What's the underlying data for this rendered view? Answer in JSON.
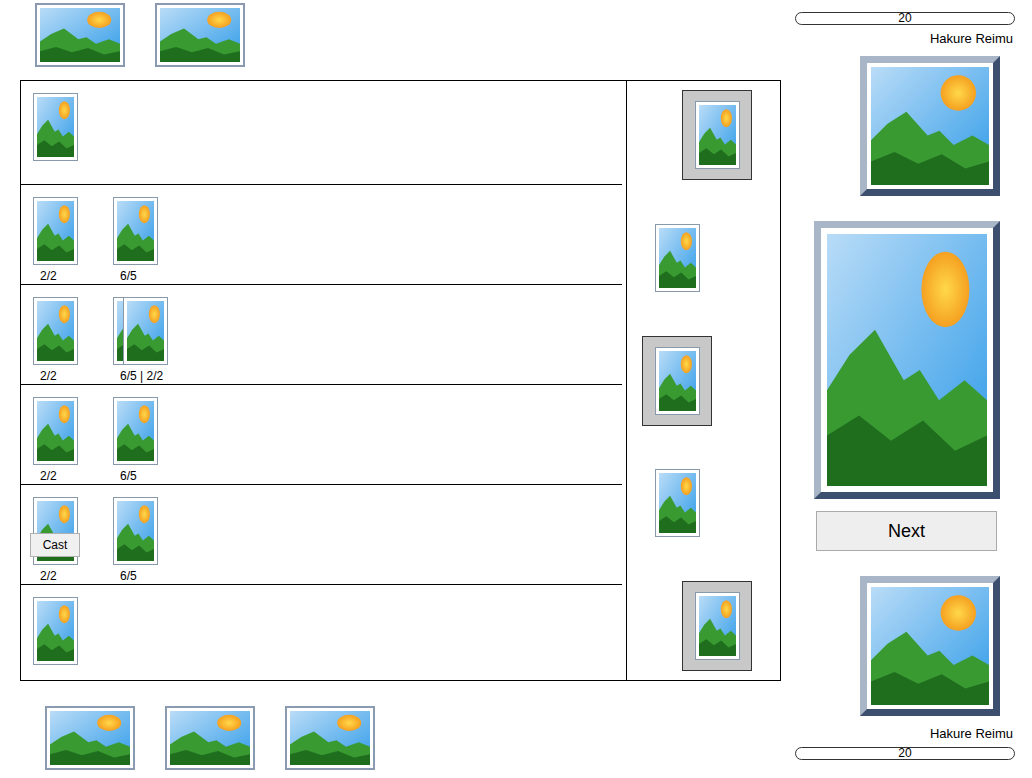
{
  "opponent": {
    "name": "Hakure Reimu",
    "life": "20",
    "hand": [
      {
        "selected": false
      },
      {
        "selected": false
      }
    ]
  },
  "lanes": [
    {
      "units": [
        {
          "kind": "card"
        }
      ]
    },
    {
      "units": [
        {
          "kind": "creature",
          "stats": "2/2"
        },
        {
          "kind": "creature",
          "stats": "6/5"
        }
      ]
    },
    {
      "units": [
        {
          "kind": "creature",
          "stats": "2/2"
        },
        {
          "kind": "stack",
          "stats": "6/5 | 2/2"
        }
      ]
    },
    {
      "units": [
        {
          "kind": "creature",
          "stats": "2/2"
        },
        {
          "kind": "creature",
          "stats": "6/5"
        }
      ]
    },
    {
      "units": [
        {
          "kind": "creature",
          "stats": "2/2",
          "action": "Cast"
        },
        {
          "kind": "creature",
          "stats": "6/5"
        }
      ]
    },
    {
      "units": [
        {
          "kind": "card"
        }
      ]
    }
  ],
  "side_cards": [
    {
      "selected": true,
      "forward": true
    },
    {
      "selected": false,
      "forward": false
    },
    {
      "selected": true,
      "forward": false
    },
    {
      "selected": false,
      "forward": false
    },
    {
      "selected": true,
      "forward": true
    }
  ],
  "preview": {
    "button": "Next"
  },
  "player": {
    "name": "Hakure Reimu",
    "life": "20",
    "hand": [
      {
        "selected": false
      },
      {
        "selected": false
      },
      {
        "selected": false
      }
    ]
  }
}
